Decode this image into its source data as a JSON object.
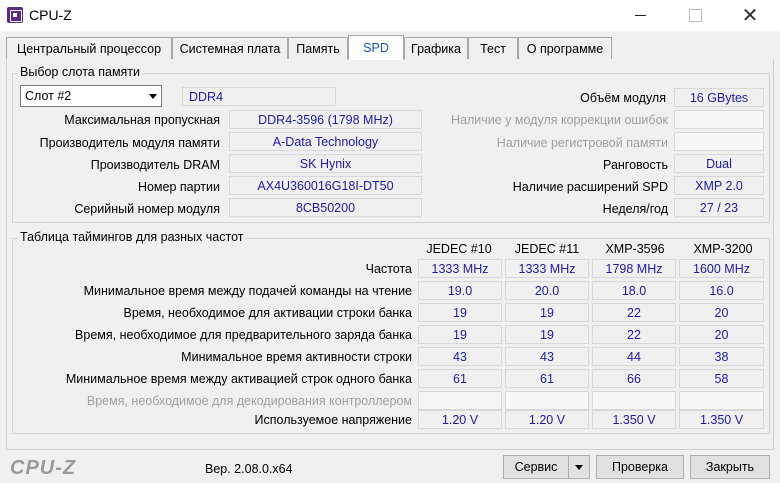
{
  "window": {
    "title": "CPU-Z",
    "close_glyph": "✕"
  },
  "tabs": [
    "Центральный процессор",
    "Системная плата",
    "Память",
    "SPD",
    "Графика",
    "Тест",
    "О программе"
  ],
  "slot_group": {
    "title": "Выбор слота памяти",
    "slot_selected": "Слот #2",
    "memory_type": "DDR4",
    "left_labels": [
      "Максимальная пропускная",
      "Производитель модуля памяти",
      "Производитель DRAM",
      "Номер партии",
      "Серийный номер модуля"
    ],
    "left_values": [
      "DDR4-3596 (1798 MHz)",
      "A-Data Technology",
      "SK Hynix",
      "AX4U360016G18I-DT50",
      "8CB50200"
    ],
    "module_size_label": "Объём модуля",
    "module_size": "16 GBytes",
    "right_labels": [
      "Наличие у модуля коррекции ошибок",
      "Наличие регистровой памяти",
      "Ранговость",
      "Наличие расширений SPD",
      "Неделя/год"
    ],
    "right_values": [
      "",
      "",
      "Dual",
      "XMP 2.0",
      "27 / 23"
    ]
  },
  "timings_group": {
    "title": "Таблица таймингов для разных частот",
    "columns": [
      "JEDEC #10",
      "JEDEC #11",
      "XMP-3596",
      "XMP-3200"
    ],
    "rows": [
      {
        "label": "Частота",
        "values": [
          "1333 MHz",
          "1333 MHz",
          "1798 MHz",
          "1600 MHz"
        ]
      },
      {
        "label": "Минимальное время между подачей команды на чтение",
        "values": [
          "19.0",
          "20.0",
          "18.0",
          "16.0"
        ]
      },
      {
        "label": "Время, необходимое для активации строки банка",
        "values": [
          "19",
          "19",
          "22",
          "20"
        ]
      },
      {
        "label": "Время, необходимое для предварительного заряда банка",
        "values": [
          "19",
          "19",
          "22",
          "20"
        ]
      },
      {
        "label": "Минимальное время активности строки",
        "values": [
          "43",
          "43",
          "44",
          "38"
        ]
      },
      {
        "label": "Минимальное время между активацией строк одного банка",
        "values": [
          "61",
          "61",
          "66",
          "58"
        ]
      },
      {
        "label": "Время, необходимое для декодирования контроллером",
        "values": [
          "",
          "",
          "",
          ""
        ]
      },
      {
        "label": "Используемое напряжение",
        "values": [
          "1.20 V",
          "1.20 V",
          "1.350 V",
          "1.350 V"
        ]
      }
    ]
  },
  "footer": {
    "brand": "CPU-Z",
    "version": "Вер. 2.08.0.x64",
    "service_label": "Сервис",
    "validate_label": "Проверка",
    "close_label": "Закрыть"
  }
}
